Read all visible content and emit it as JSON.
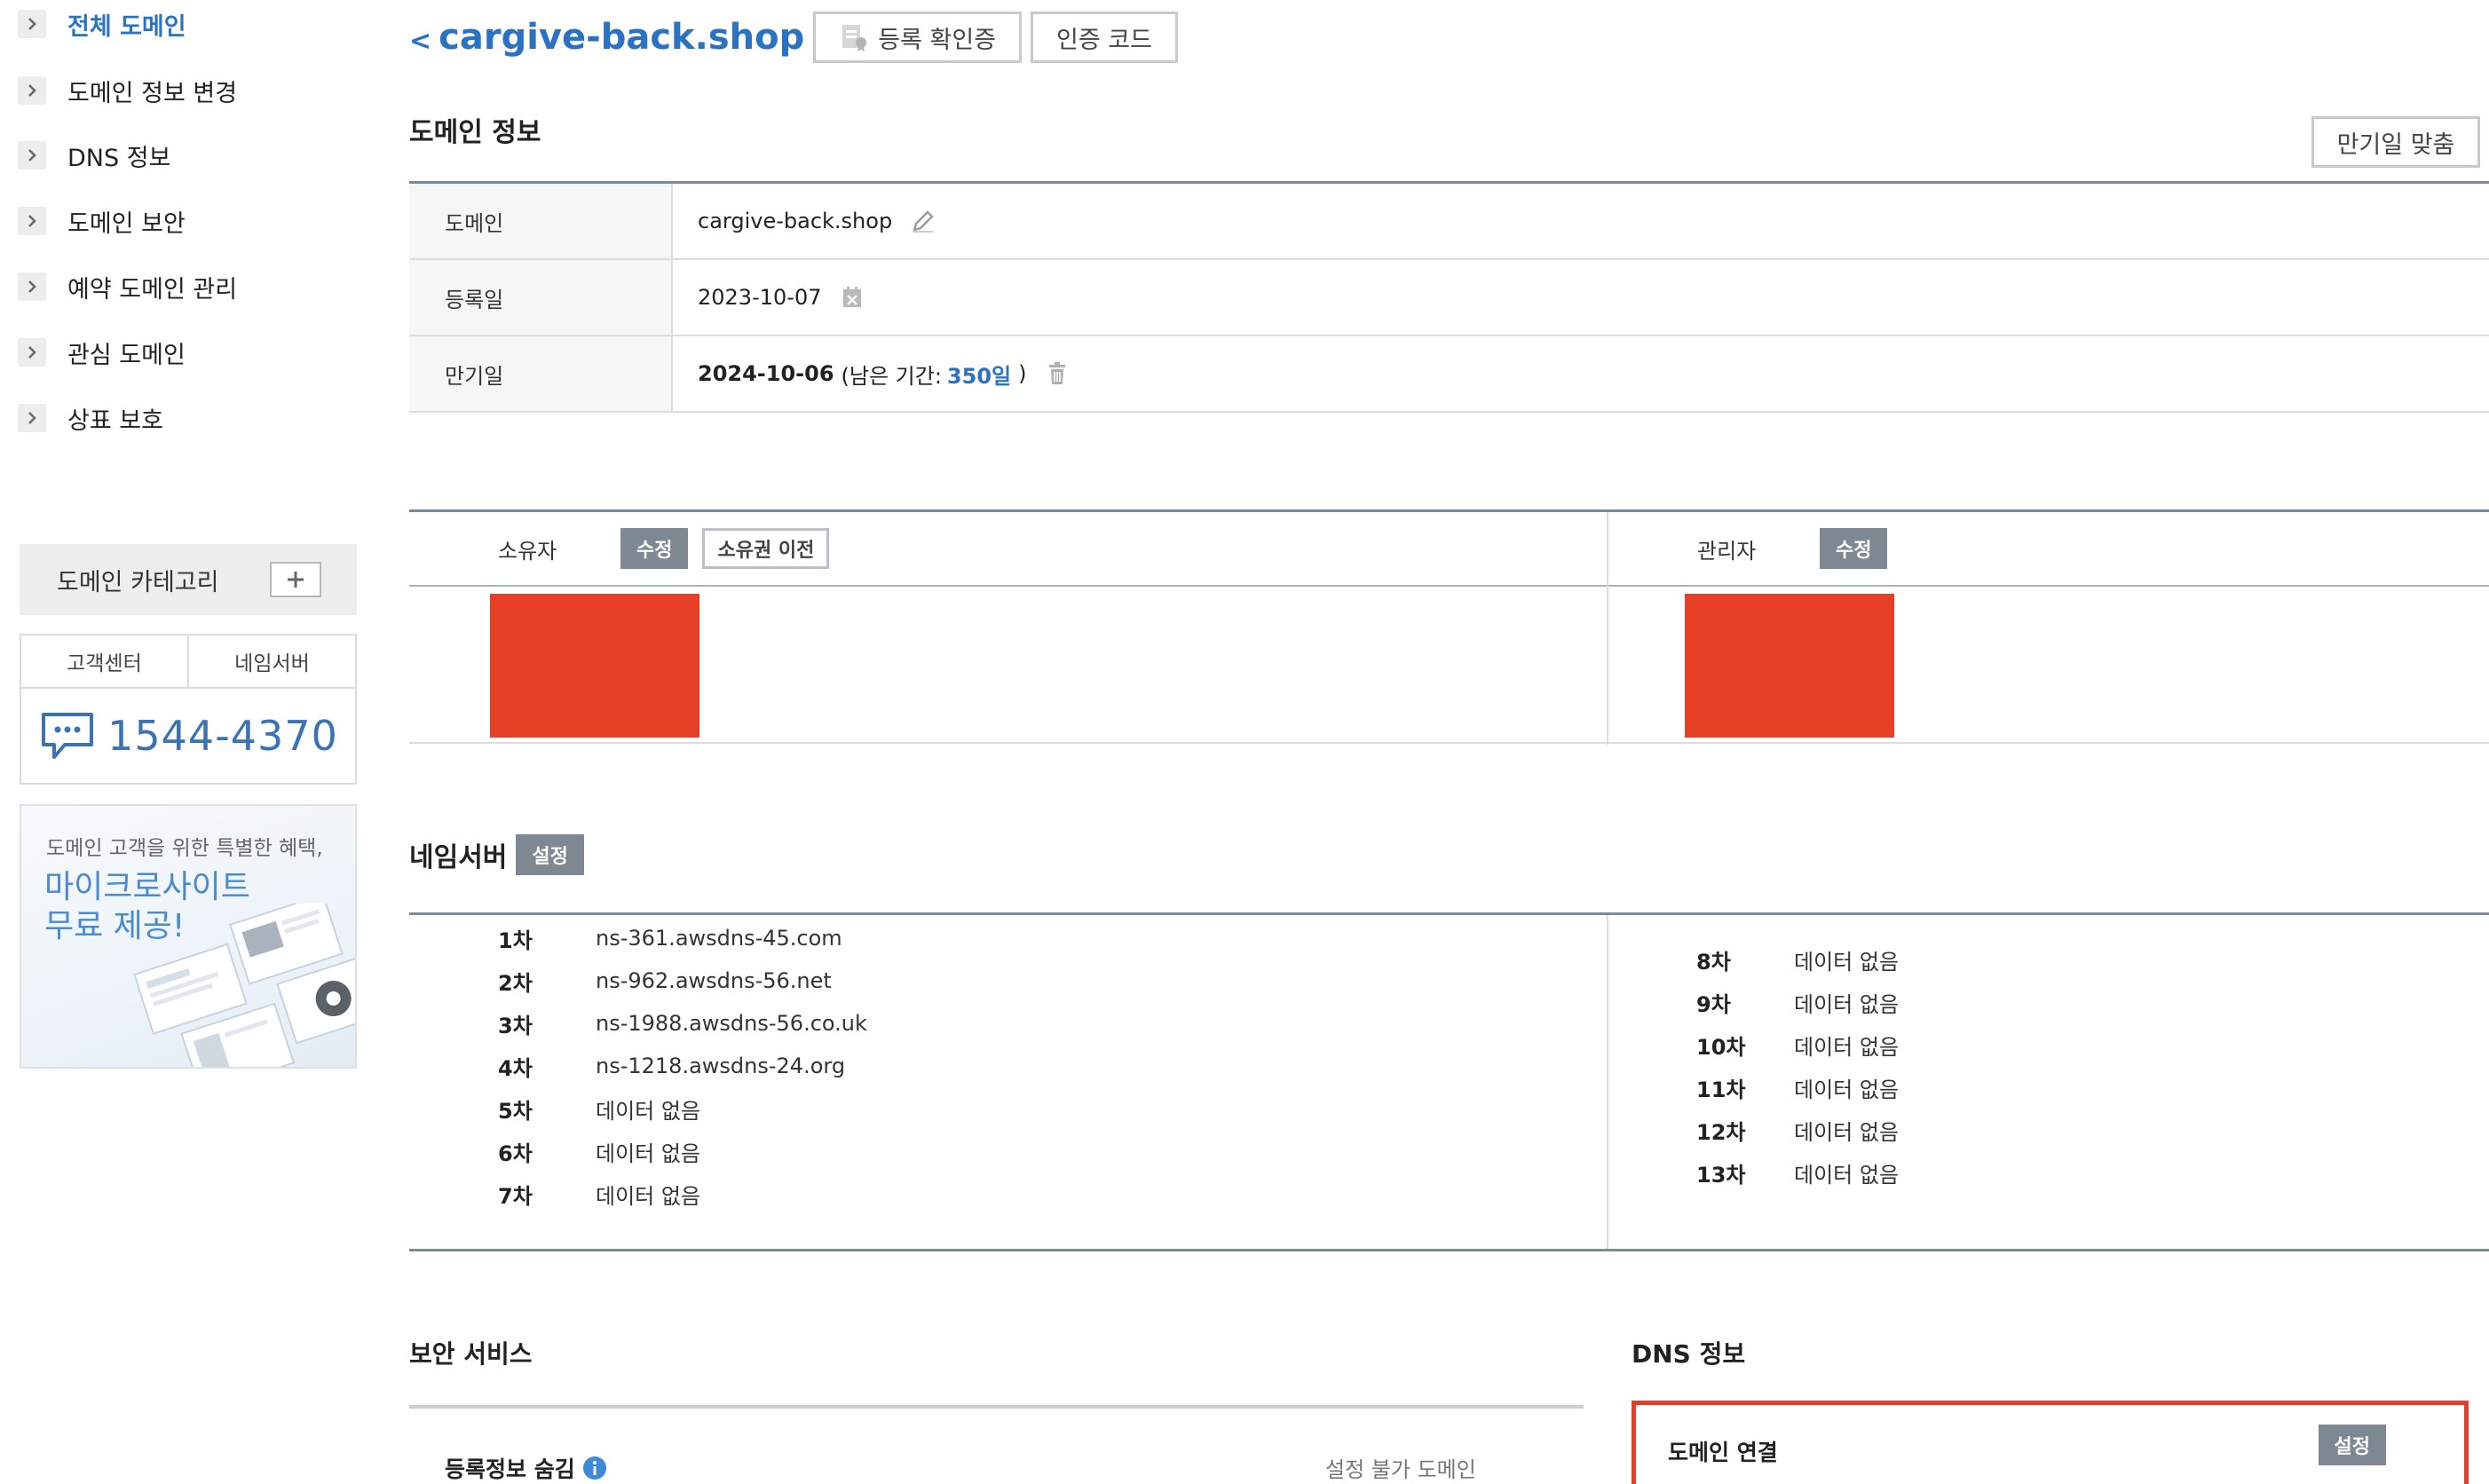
{
  "sidebar": {
    "items": [
      {
        "label": "전체 도메인",
        "active": true
      },
      {
        "label": "도메인 정보 변경"
      },
      {
        "label": "DNS 정보"
      },
      {
        "label": "도메인 보안"
      },
      {
        "label": "예약 도메인 관리"
      },
      {
        "label": "관심 도메인"
      },
      {
        "label": "상표 보호"
      }
    ],
    "category_label": "도메인 카테고리",
    "support_tabs": [
      "고객센터",
      "네임서버"
    ],
    "phone": "1544-4370",
    "promo_subtitle": "도메인 고객을 위한 특별한 혜택,",
    "promo_title_line1": "마이크로사이트",
    "promo_title_line2": "무료 제공!"
  },
  "header": {
    "back_symbol": "<",
    "domain": "cargive-back.shop",
    "certificate_button": "등록 확인증",
    "auth_code_button": "인증 코드"
  },
  "domain_info": {
    "title": "도메인 정보",
    "expiry_match_button": "만기일 맞춤",
    "rows": [
      {
        "label": "도메인",
        "value": "cargive-back.shop"
      },
      {
        "label": "등록일",
        "value": "2023-10-07"
      },
      {
        "label": "만기일",
        "value": "2024-10-06",
        "remaining_prefix": "(남은 기간:",
        "remaining_value": "350일",
        "remaining_suffix": ")"
      }
    ]
  },
  "contacts": {
    "owner_label": "소유자",
    "owner_edit": "수정",
    "owner_transfer": "소유권 이전",
    "admin_label": "관리자",
    "admin_edit": "수정"
  },
  "nameserver": {
    "title": "네임서버",
    "setting_button": "설정",
    "left": [
      {
        "idx": "1차",
        "value": "ns-361.awsdns-45.com"
      },
      {
        "idx": "2차",
        "value": "ns-962.awsdns-56.net"
      },
      {
        "idx": "3차",
        "value": "ns-1988.awsdns-56.co.uk"
      },
      {
        "idx": "4차",
        "value": "ns-1218.awsdns-24.org"
      },
      {
        "idx": "5차",
        "value": "데이터 없음"
      },
      {
        "idx": "6차",
        "value": "데이터 없음"
      },
      {
        "idx": "7차",
        "value": "데이터 없음"
      }
    ],
    "right": [
      {
        "idx": "8차",
        "value": "데이터 없음"
      },
      {
        "idx": "9차",
        "value": "데이터 없음"
      },
      {
        "idx": "10차",
        "value": "데이터 없음"
      },
      {
        "idx": "11차",
        "value": "데이터 없음"
      },
      {
        "idx": "12차",
        "value": "데이터 없음"
      },
      {
        "idx": "13차",
        "value": "데이터 없음"
      }
    ]
  },
  "security": {
    "title": "보안 서비스",
    "hidden_info_label": "등록정보 숨김",
    "hidden_info_status": "설정 불가 도메인"
  },
  "dns": {
    "title": "DNS 정보",
    "link_label": "도메인 연결",
    "setting_button": "설정"
  },
  "colors": {
    "accent_blue": "#2a73c4",
    "redaction": "#e84027",
    "button_gray": "#7e8893"
  }
}
